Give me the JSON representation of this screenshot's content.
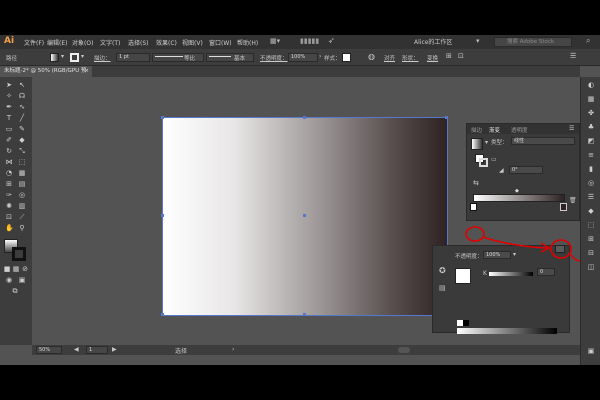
{
  "menubar": {
    "logo": "Ai",
    "items": [
      "文件(F)",
      "编辑(E)",
      "对象(O)",
      "文字(T)",
      "选择(S)",
      "效果(C)",
      "视图(V)",
      "窗口(W)",
      "帮助(H)"
    ],
    "workspace": "Alice的工作区",
    "search_placeholder": "搜索 Adobe Stock"
  },
  "controlbar": {
    "path_label": "路径",
    "stroke_label": "描边：",
    "stroke_value": "1 pt",
    "brush_label": "等比",
    "basic_label": "基本",
    "opacity_label": "不透明度：",
    "opacity_value": "100%",
    "style_label": "样式：",
    "align_label": "对齐",
    "shape_label": "形状：",
    "transform_label": "变换"
  },
  "document": {
    "tab_title": "未标题-2* @ 50% (RGB/GPU 预览)"
  },
  "statusbar": {
    "zoom": "50%",
    "page": "1",
    "tool_name": "选择"
  },
  "gradient_panel": {
    "tabs": [
      "描边",
      "渐变",
      "透明度"
    ],
    "type_label": "类型：",
    "type_value": "线性",
    "angle_value": "0°"
  },
  "transparency_panel": {
    "opacity_label": "不透明度：",
    "opacity_value": "100%",
    "value_field": "0"
  },
  "colors": {
    "accent": "#5577cc",
    "highlight": "#e00000",
    "gradient_start": "#ffffff",
    "gradient_end": "#2e2222"
  }
}
